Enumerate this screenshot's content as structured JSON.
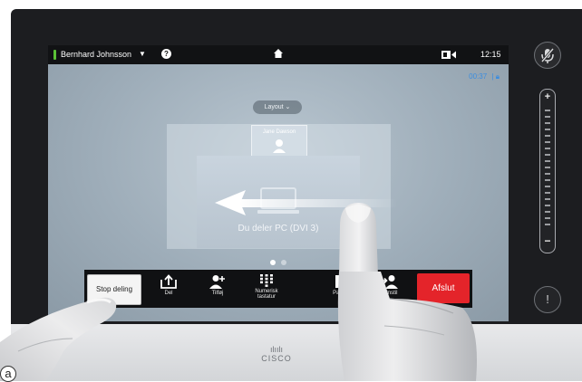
{
  "status_bar": {
    "user_name": "Bernhard Johnsson",
    "caret": "▼",
    "help": "?",
    "home_icon": "home-icon",
    "camera_icon": "camera-icon",
    "time": "12:15"
  },
  "call": {
    "duration": "00:37",
    "lock_icon": "lock-icon"
  },
  "layout_button": "Layout ⌄",
  "participant": {
    "name": "Jane Dawson"
  },
  "share": {
    "text": "Du deler PC (DVI 3)"
  },
  "page_dots": {
    "count": 2,
    "active": 0
  },
  "toolbar": {
    "stop_label": "Stop deling",
    "share_label": "Del",
    "add_label": "Tilføj",
    "keypad_label_line1": "Numerisk",
    "keypad_label_line2": "tastatur",
    "park_label": "Parkér",
    "transfer_label": "Omstil",
    "end_label": "Afslut"
  },
  "side_controls": {
    "mute_icon": "mic-mute-icon",
    "volume_plus": "+",
    "volume_minus": "−",
    "alert": "!"
  },
  "brand": {
    "bars": "ılıılı",
    "name": "CISCO"
  },
  "figure_label": "a",
  "colors": {
    "end_call": "#e4242a",
    "timer": "#3b8de0",
    "status_dot": "#5bc236"
  }
}
